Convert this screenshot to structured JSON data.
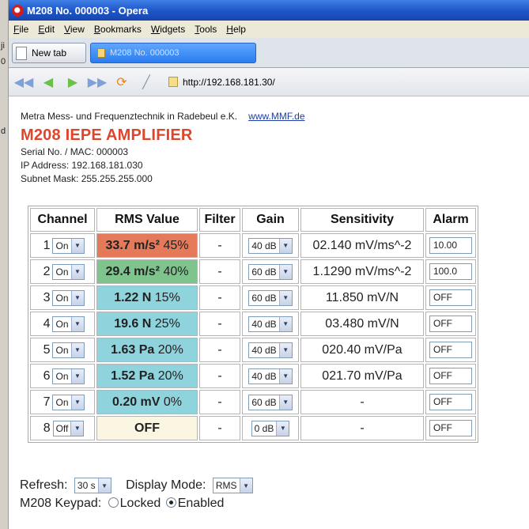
{
  "window": {
    "title": "M208 No. 000003 - Opera"
  },
  "menu": [
    "File",
    "Edit",
    "View",
    "Bookmarks",
    "Widgets",
    "Tools",
    "Help"
  ],
  "tabs": {
    "new_tab": "New tab",
    "active": "M208 No. 000003"
  },
  "address": "http://192.168.181.30/",
  "page": {
    "company": "Metra Mess- und Frequenztechnik in Radebeul e.K.",
    "link": "www.MMF.de",
    "product": "M208 IEPE AMPLIFIER",
    "serial": "Serial No. / MAC: 000003",
    "ip": "IP Address: 192.168.181.030",
    "mask": "Subnet Mask: 255.255.255.000"
  },
  "table": {
    "headers": [
      "Channel",
      "RMS Value",
      "Filter",
      "Gain",
      "Sensitivity",
      "Alarm"
    ],
    "rows": [
      {
        "num": "1",
        "state": "On",
        "value": "33.7 m/s²",
        "pct": "45%",
        "filter": "-",
        "gain": "40 dB",
        "sens": "02.140 mV/ms^-2",
        "alarm": "10.00"
      },
      {
        "num": "2",
        "state": "On",
        "value": "29.4 m/s²",
        "pct": "40%",
        "filter": "-",
        "gain": "60 dB",
        "sens": "1.1290 mV/ms^-2",
        "alarm": "100.0"
      },
      {
        "num": "3",
        "state": "On",
        "value": "1.22 N",
        "pct": "15%",
        "filter": "-",
        "gain": "60 dB",
        "sens": "11.850 mV/N",
        "alarm": "OFF"
      },
      {
        "num": "4",
        "state": "On",
        "value": "19.6 N",
        "pct": "25%",
        "filter": "-",
        "gain": "40 dB",
        "sens": "03.480 mV/N",
        "alarm": "OFF"
      },
      {
        "num": "5",
        "state": "On",
        "value": "1.63 Pa",
        "pct": "20%",
        "filter": "-",
        "gain": "40 dB",
        "sens": "020.40 mV/Pa",
        "alarm": "OFF"
      },
      {
        "num": "6",
        "state": "On",
        "value": "1.52 Pa",
        "pct": "20%",
        "filter": "-",
        "gain": "40 dB",
        "sens": "021.70 mV/Pa",
        "alarm": "OFF"
      },
      {
        "num": "7",
        "state": "On",
        "value": "0.20 mV",
        "pct": "0%",
        "filter": "-",
        "gain": "60 dB",
        "sens": "-",
        "alarm": "OFF"
      },
      {
        "num": "8",
        "state": "Off",
        "value": "OFF",
        "pct": "",
        "filter": "-",
        "gain": "0 dB",
        "sens": "-",
        "alarm": "OFF"
      }
    ]
  },
  "controls": {
    "refresh_label": "Refresh:",
    "refresh_value": "30 s",
    "display_label": "Display Mode:",
    "display_value": "RMS",
    "keypad_label": "M208 Keypad:",
    "locked": "Locked",
    "enabled": "Enabled"
  },
  "colors": {
    "title_red": "#e0452b",
    "rms_red": "#e57a5b",
    "rms_green": "#7fc38d",
    "rms_blue": "#8fd3dc",
    "rms_off": "#fbf6e2"
  }
}
